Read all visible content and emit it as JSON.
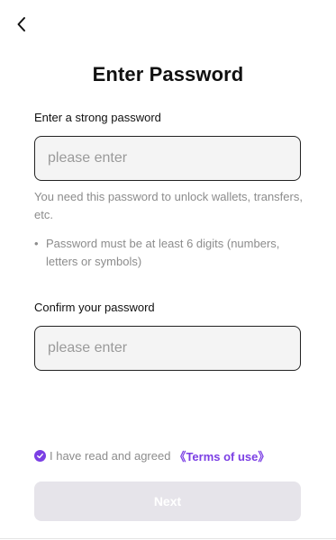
{
  "header": {
    "back_icon": "chevron-left-icon",
    "title": "Enter Password"
  },
  "password": {
    "label": "Enter a strong password",
    "value": "",
    "placeholder": "please enter",
    "help_text": "You need this password to unlock wallets, transfers, etc.",
    "rule_bullet": "•",
    "rule_text": "Password must be at least 6 digits (numbers, letters or symbols)"
  },
  "confirm": {
    "label": "Confirm your password",
    "value": "",
    "placeholder": "please enter"
  },
  "agreement": {
    "checked": true,
    "check_icon": "check-circle-icon",
    "text": "I have read and agreed",
    "link_text": "《Terms of use》"
  },
  "footer": {
    "next_label": "Next"
  },
  "colors": {
    "accent": "#7b3fe4",
    "disabled_button": "#e6e4ea",
    "muted_text": "#8c8c8c",
    "input_background": "#f4f4f4"
  }
}
